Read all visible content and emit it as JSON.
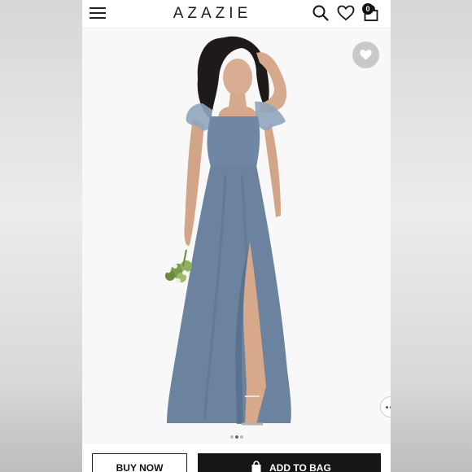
{
  "header": {
    "logo": "AZAZIE",
    "bag_count": "0"
  },
  "product": {
    "image_alt": "woman in dusty blue flutter-sleeve chiffon gown with thigh slit holding bouquet"
  },
  "actions": {
    "buy_now_label": "BUY NOW",
    "add_to_bag_label": "ADD TO BAG"
  },
  "colors": {
    "dress": "#6f87a3",
    "accent_dark": "#151515",
    "background": "#ffffff"
  }
}
